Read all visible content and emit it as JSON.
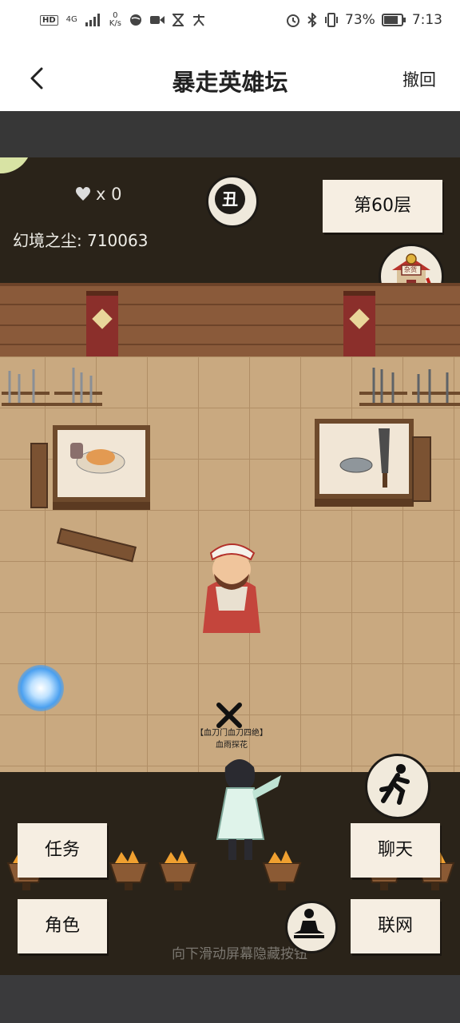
{
  "status_bar": {
    "network_badge": "HD",
    "signal_label": "4G",
    "speed_value": "0",
    "speed_unit": "K/s",
    "battery_percent": "73%",
    "time": "7:13"
  },
  "nav": {
    "title": "暴走英雄坛",
    "undo_label": "撤回"
  },
  "hud": {
    "hearts_label": "x 0",
    "dust_label": "幻境之尘: 710063",
    "medal_glyph": "丑",
    "floor_label": "第60层",
    "shop_label": "杂货"
  },
  "scene": {
    "hero_title": "【血刀门血刀四绝】",
    "hero_name": "血雨探花"
  },
  "buttons": {
    "task": "任务",
    "chat": "聊天",
    "role": "角色",
    "network": "联网"
  },
  "hint": "向下滑动屏幕隐藏按钮",
  "colors": {
    "paper": "#f6eee2",
    "game_bg": "#2a2319",
    "floor": "#c9a980",
    "wall": "#8a5a3a",
    "gamepad_bubble": "#d8e3a4"
  }
}
